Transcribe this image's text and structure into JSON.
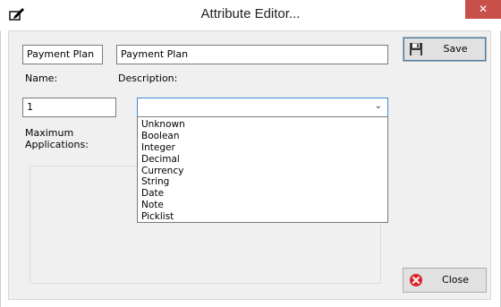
{
  "window": {
    "title": "Attribute Editor...",
    "close_glyph": "✕",
    "app_icon": "pencil-edit-icon"
  },
  "fields": {
    "name_value": "Payment Plan",
    "name_label": "Name:",
    "description_value": "Payment Plan",
    "description_label": "Description:",
    "max_apps_value": "1",
    "max_apps_label_line1": "Maximum",
    "max_apps_label_line2": "Applications:"
  },
  "type_select": {
    "selected": "",
    "chevron_glyph": "⌄",
    "options": [
      "Unknown",
      "Boolean",
      "Integer",
      "Decimal",
      "Currency",
      "String",
      "Date",
      "Note",
      "Picklist"
    ]
  },
  "buttons": {
    "save_label": "Save",
    "save_icon": "floppy-disk-icon",
    "close_label": "Close",
    "close_icon": "red-x-circle-icon"
  },
  "colors": {
    "accent": "#3d8bd4",
    "close_red": "#c7504a",
    "dialog_bg": "#f0f0f0"
  }
}
